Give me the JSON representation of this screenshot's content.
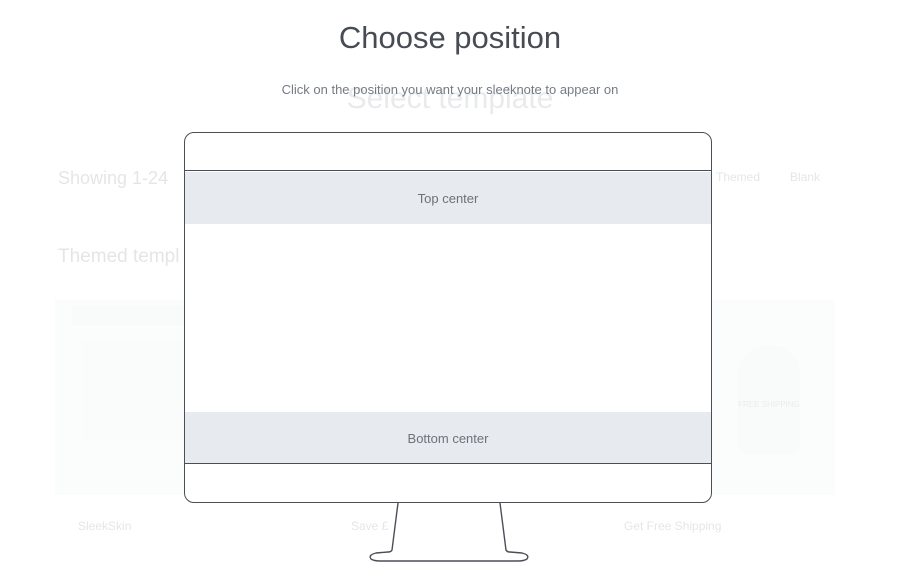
{
  "background": {
    "title": "Select template",
    "showing": "Showing 1-24",
    "filters": [
      "Themed",
      "Blank"
    ],
    "themed_heading": "Themed templ",
    "bottle_text": "FREE SHIPPING",
    "card_labels": [
      "SleekSkin",
      "Save £",
      "Get Free Shipping"
    ]
  },
  "modal": {
    "title": "Choose position",
    "subtitle": "Click on the position you want your sleeknote to appear on",
    "positions": {
      "top": "Top center",
      "bottom": "Bottom center"
    }
  }
}
